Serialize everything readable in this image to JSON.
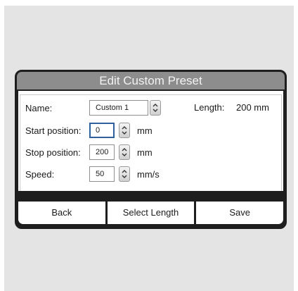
{
  "dialog": {
    "title": "Edit Custom Preset",
    "name": {
      "label": "Name:",
      "value": "Custom 1"
    },
    "length": {
      "label": "Length:",
      "value": "200 mm"
    },
    "start_position": {
      "label": "Start position:",
      "value": "0",
      "unit": "mm"
    },
    "stop_position": {
      "label": "Stop position:",
      "value": "200",
      "unit": "mm"
    },
    "speed": {
      "label": "Speed:",
      "value": "50",
      "unit": "mm/s"
    },
    "buttons": {
      "back": "Back",
      "select_length": "Select Length",
      "save": "Save"
    }
  },
  "icons": {
    "spinner": "up-down-arrows-icon"
  },
  "colors": {
    "title_bar": "#8d8d8d",
    "frame": "#1e1e1e",
    "focus": "#2f5f9c"
  }
}
